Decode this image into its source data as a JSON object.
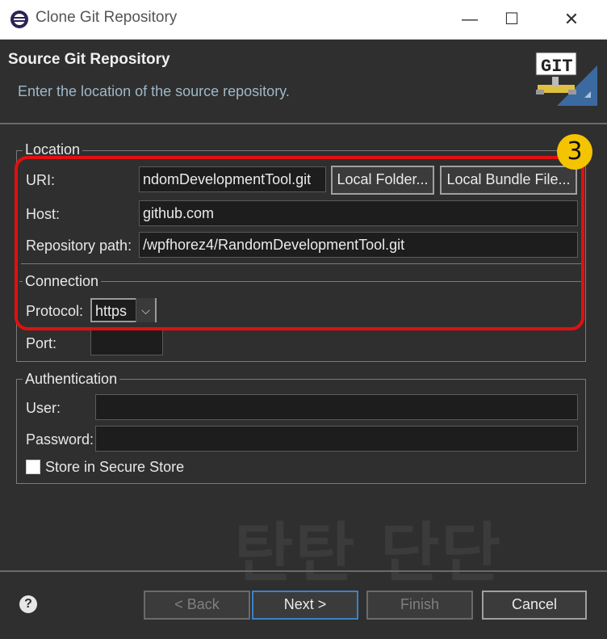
{
  "window": {
    "title": "Clone Git Repository",
    "min_icon": "minimize-icon",
    "max_icon": "maximize-icon",
    "close_icon": "close-icon"
  },
  "header": {
    "title": "Source Git Repository",
    "description": "Enter the location of the source repository.",
    "logo_text": "GIT"
  },
  "location": {
    "legend": "Location",
    "uri_label": "URI:",
    "uri_value": "ndomDevelopmentTool.git",
    "local_folder_button": "Local Folder...",
    "local_bundle_button": "Local Bundle File...",
    "host_label": "Host:",
    "host_value": "github.com",
    "repo_path_label": "Repository path:",
    "repo_path_value": "/wpfhorez4/RandomDevelopmentTool.git"
  },
  "connection": {
    "legend": "Connection",
    "protocol_label": "Protocol:",
    "protocol_value": "https",
    "port_label": "Port:",
    "port_value": ""
  },
  "authentication": {
    "legend": "Authentication",
    "user_label": "User:",
    "user_value": "",
    "password_label": "Password:",
    "password_value": "",
    "store_label": "Store in Secure Store",
    "store_checked": false
  },
  "badge": "3",
  "watermark": "탄탄 단단",
  "buttons": {
    "back": "< Back",
    "next": "Next >",
    "finish": "Finish",
    "cancel": "Cancel"
  },
  "colors": {
    "highlight": "#e01010",
    "badge": "#f5c400",
    "background": "#2f2f2f"
  }
}
